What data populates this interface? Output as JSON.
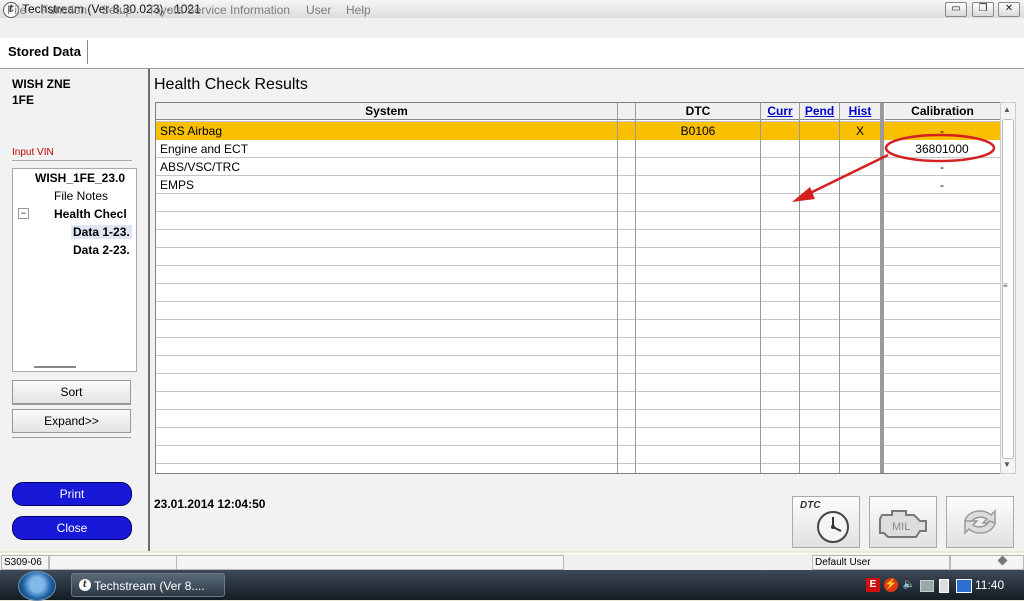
{
  "window": {
    "title": "Techstream (Ver 8.30.023) - 1021",
    "app_icon_glyph": "t",
    "minimize_glyph": "▭",
    "maximize_glyph": "❐",
    "close_glyph": "✕"
  },
  "menu": [
    "File",
    "Function",
    "Setup",
    "Toyota Service Information",
    "User",
    "Help"
  ],
  "tab": {
    "label": "Stored Data"
  },
  "left": {
    "vehicle_line1": "WISH ZNE",
    "vehicle_line2": "1FE",
    "input_vin": "Input VIN",
    "tree": {
      "root": "WISH_1FE_23.0",
      "file_notes": "File Notes",
      "expander": "−",
      "health_check": "Health Checl",
      "data1": "Data 1-23.",
      "data2": "Data 2-23."
    },
    "sort_label": "Sort",
    "expand_label": "Expand>>",
    "print_label": "Print",
    "close_label": "Close"
  },
  "main": {
    "title": "Health Check Results",
    "columns": {
      "system": "System",
      "dtc": "DTC",
      "curr": "Curr",
      "pend": "Pend",
      "hist": "Hist",
      "calibration": "Calibration"
    },
    "rows": [
      {
        "system": "SRS Airbag",
        "dtc": "B0106",
        "hist": "X",
        "calibration": "-",
        "selected": true
      },
      {
        "system": "Engine and ECT",
        "dtc": "",
        "hist": "",
        "calibration": "36801000",
        "selected": false
      },
      {
        "system": "ABS/VSC/TRC",
        "dtc": "",
        "hist": "",
        "calibration": "-",
        "selected": false
      },
      {
        "system": "EMPS",
        "dtc": "",
        "hist": "",
        "calibration": "-",
        "selected": false
      }
    ],
    "timestamp": "23.01.2014 12:04:50",
    "annotation_color": "#d42020",
    "selected_row_color": "#f8c000",
    "buttons": {
      "dtc_label": "DTC",
      "dtc_icon": "dtc-clock-icon",
      "mil_label": "MIL",
      "mil_icon": "engine-mil-icon",
      "refresh_icon": "refresh-icon"
    }
  },
  "status": {
    "code": "S309-06",
    "user": "Default User"
  },
  "taskbar": {
    "task_label": "Techstream (Ver 8....",
    "tray_e": "E",
    "clock": "11:40"
  }
}
